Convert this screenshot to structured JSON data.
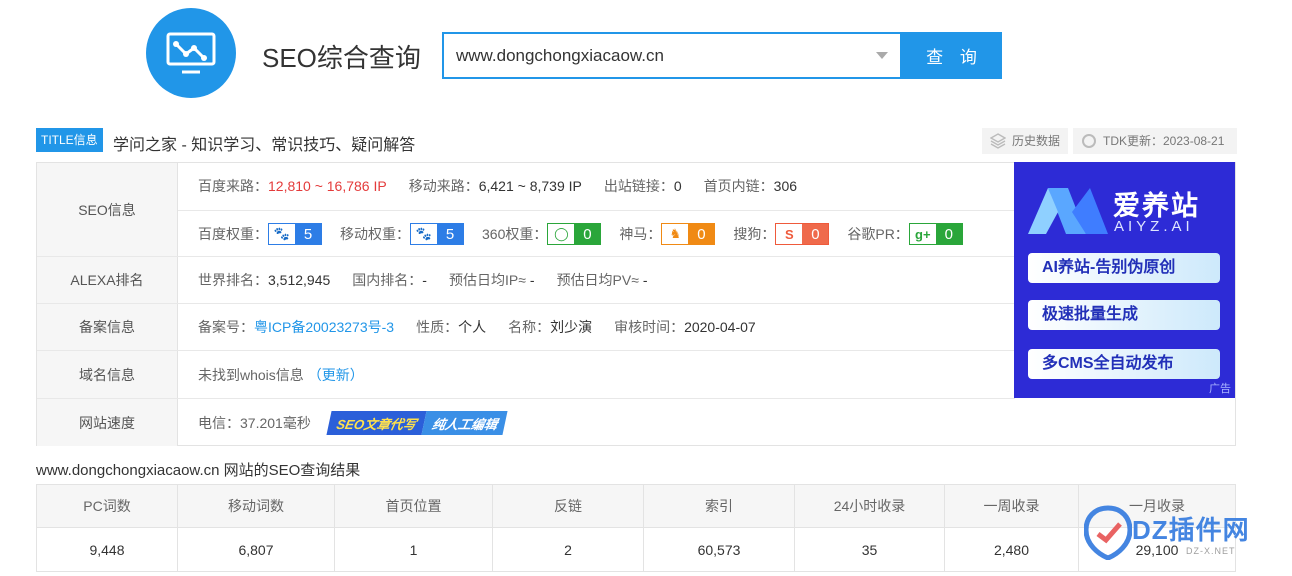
{
  "header": {
    "brand": "SEO综合查询",
    "search_value": "www.dongchongxiacaow.cn",
    "search_button": "查 询"
  },
  "title_row": {
    "tag": "TITLE信息",
    "text": "学问之家 - 知识学习、常识技巧、疑问解答",
    "history_button": "历史数据",
    "tdk_update": "TDK更新：2023-08-21"
  },
  "seo_info": {
    "label": "SEO信息",
    "baidu_traffic_label": "百度来路：",
    "baidu_traffic_value": "12,810 ~ 16,786 IP",
    "mobile_traffic_label": "移动来路：",
    "mobile_traffic_value": "6,421 ~ 8,739 IP",
    "outbound_label": "出站链接：",
    "outbound_value": "0",
    "homepage_links_label": "首页内链：",
    "homepage_links_value": "306",
    "weights": [
      {
        "label": "百度权重：",
        "value": "5"
      },
      {
        "label": "移动权重：",
        "value": "5"
      },
      {
        "label": "360权重：",
        "value": "0"
      },
      {
        "label": "神马：",
        "value": "0"
      },
      {
        "label": "搜狗：",
        "value": "0"
      },
      {
        "label": "谷歌PR：",
        "value": "0"
      }
    ]
  },
  "alexa": {
    "label": "ALEXA排名",
    "world_label": "世界排名：",
    "world_value": "3,512,945",
    "domestic_label": "国内排名：",
    "domestic_value": "-",
    "ip_label": "预估日均IP≈",
    "ip_value": "-",
    "pv_label": "预估日均PV≈",
    "pv_value": "-"
  },
  "icp": {
    "label": "备案信息",
    "number_label": "备案号：",
    "number_value": "粤ICP备20023273号-3",
    "nature_label": "性质：",
    "nature_value": "个人",
    "name_label": "名称：",
    "name_value": "刘少演",
    "audit_label": "审核时间：",
    "audit_value": "2020-04-07"
  },
  "domain": {
    "label": "域名信息",
    "text": "未找到whois信息",
    "update_link": "（更新）"
  },
  "speed": {
    "label": "网站速度",
    "telecom": "电信：37.201毫秒",
    "promo_1": "SEO文章代写",
    "promo_2": "纯人工编辑"
  },
  "ad": {
    "title": "爱养站",
    "subtitle": "AIYZ.AI",
    "items": [
      "AI养站-告别伪原创",
      "极速批量生成",
      "多CMS全自动发布"
    ],
    "tag": "广告"
  },
  "result": {
    "title": "www.dongchongxiacaow.cn 网站的SEO查询结果",
    "headers": [
      "PC词数",
      "移动词数",
      "首页位置",
      "反链",
      "索引",
      "24小时收录",
      "一周收录",
      "一月收录"
    ],
    "values": [
      "9,448",
      "6,807",
      "1",
      "2",
      "60,573",
      "35",
      "2,480",
      "29,100"
    ]
  },
  "watermark": {
    "text": "DZ插件网",
    "url": "DZ-X.NET"
  },
  "colors": {
    "primary": "#2196e8",
    "traffic_red": "#e43b3b",
    "ad_background": "#2d2bd6"
  }
}
